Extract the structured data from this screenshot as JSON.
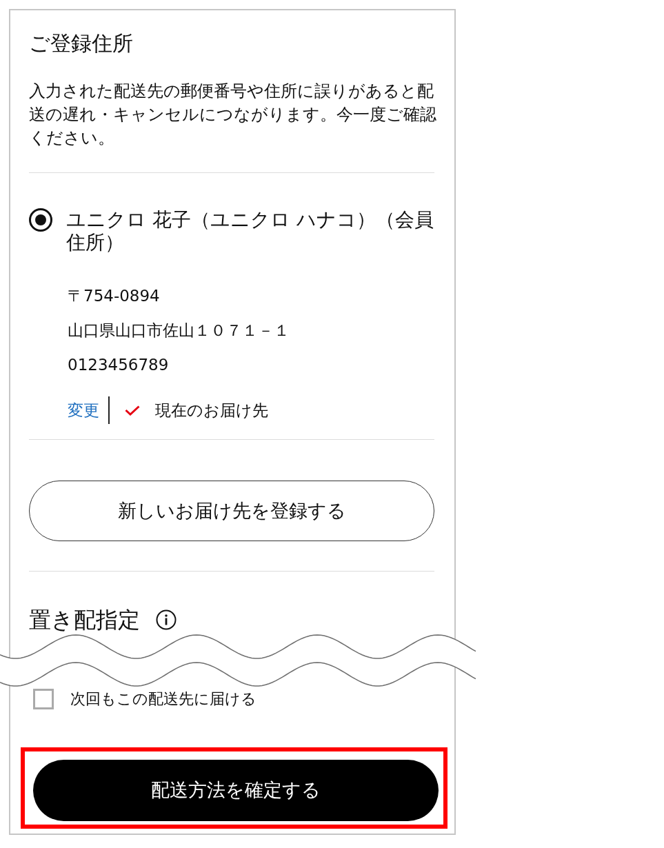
{
  "section": {
    "title": "ご登録住所",
    "notice": "入力された配送先の郵便番号や住所に誤りがあると配送の遅れ・キャンセルにつながります。今一度ご確認ください。"
  },
  "addresses": [
    {
      "name": "ユニクロ 花子（ユニクロ ハナコ）（会員住所）",
      "selected": true,
      "postal_code": "〒754-0894",
      "address": "山口県山口市佐山１０７１－１",
      "phone": "0123456789",
      "change_link": "変更",
      "current": true,
      "current_label": "現在のお届け先"
    }
  ],
  "add_address_button": "新しいお届け先を登録する",
  "drop_off": {
    "title": "置き配指定"
  },
  "save_option": {
    "label": "次回もこの配送先に届ける",
    "checked": false
  },
  "confirm_button": {
    "label": "配送方法を確定する",
    "highlighted": true
  }
}
